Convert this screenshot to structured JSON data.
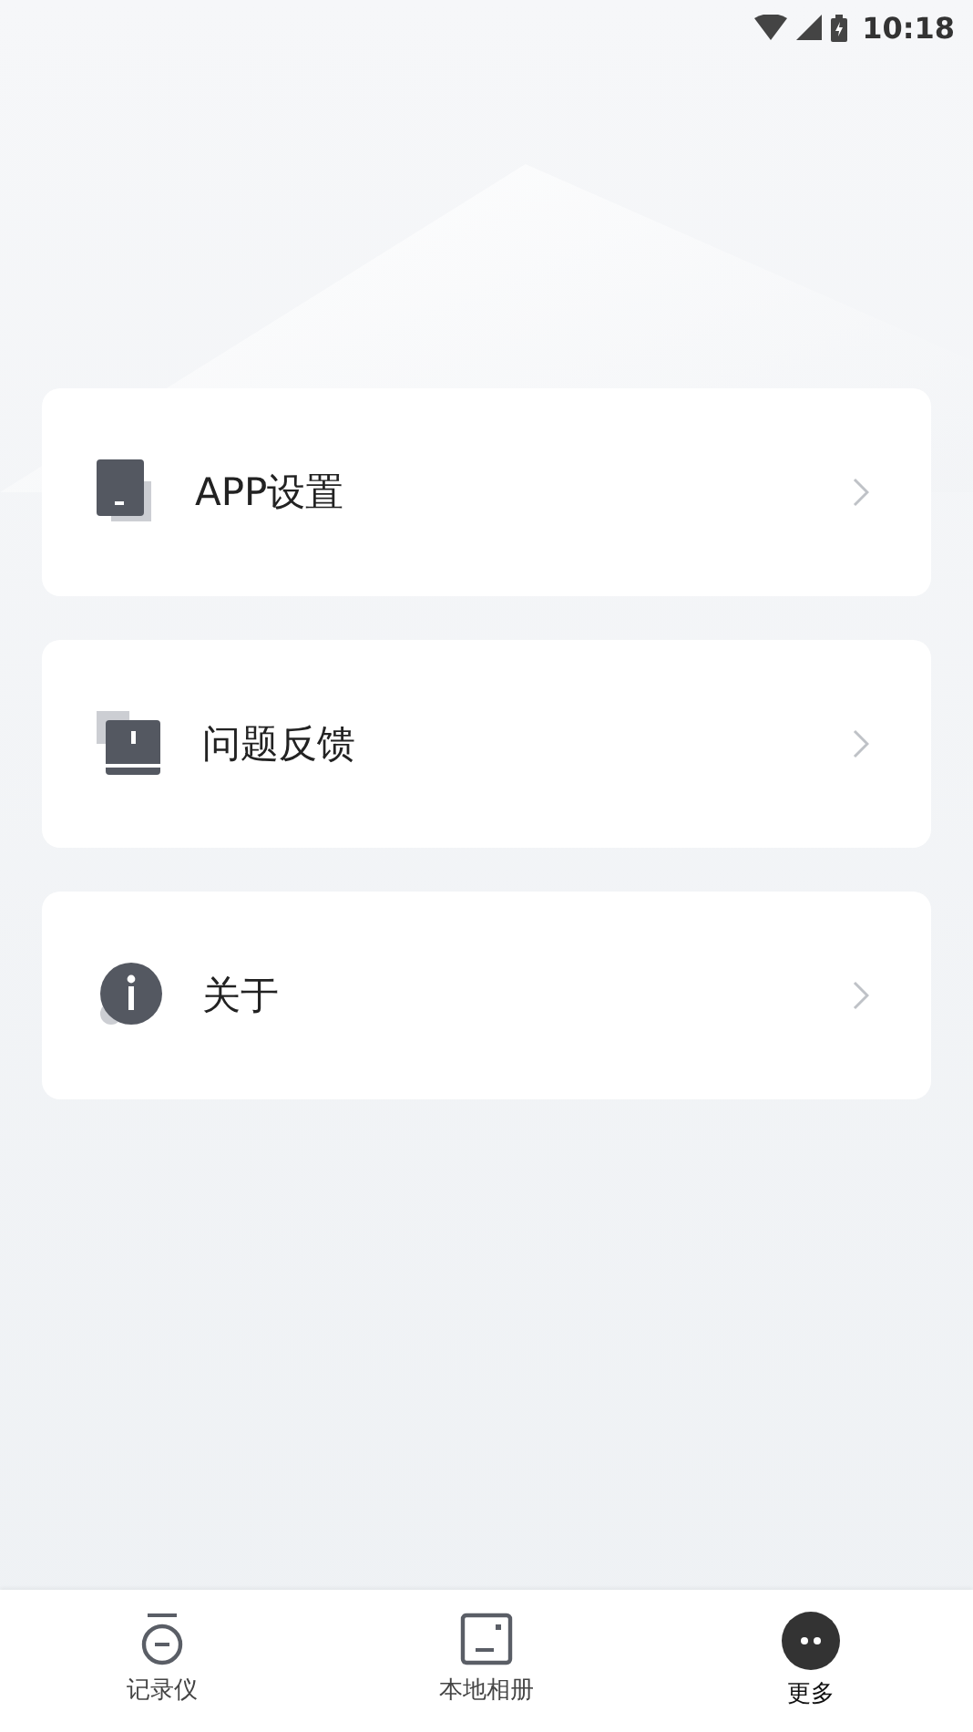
{
  "status_bar": {
    "time": "10:18"
  },
  "menu": [
    {
      "kind": "settings",
      "label": "APP设置"
    },
    {
      "kind": "feedback",
      "label": "问题反馈"
    },
    {
      "kind": "about",
      "label": "关于"
    }
  ],
  "bottom_nav": [
    {
      "kind": "recorder",
      "label": "记录仪",
      "selected": false
    },
    {
      "kind": "album",
      "label": "本地相册",
      "selected": false
    },
    {
      "kind": "more",
      "label": "更多",
      "selected": true
    }
  ]
}
